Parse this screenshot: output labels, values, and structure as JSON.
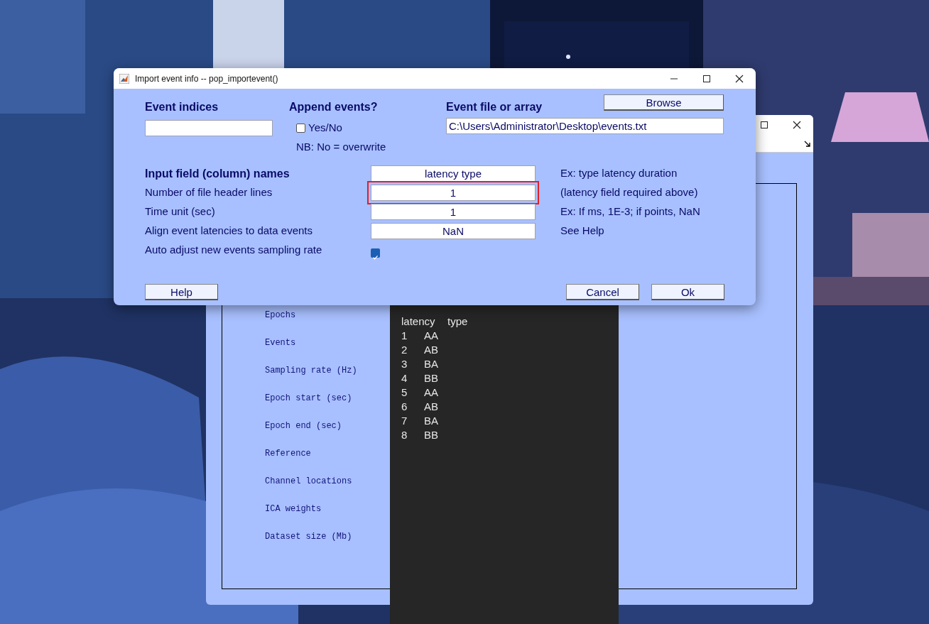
{
  "dialog": {
    "title": "Import event info -- pop_importevent()",
    "event_indices": {
      "heading": "Event indices"
    },
    "append_events": {
      "heading": "Append events?",
      "option": "Yes/No",
      "checked": false,
      "note": "NB: No = overwrite"
    },
    "event_file": {
      "heading": "Event file or array",
      "browse": "Browse",
      "value": "C:\\Users\\Administrator\\Desktop\\events.txt"
    },
    "rows": [
      {
        "kind": "field",
        "label": "Input field (column) names",
        "bold": true,
        "value": "latency type",
        "hint": "Ex: type latency duration",
        "highlighted": false
      },
      {
        "kind": "field",
        "label": "Number of file header lines",
        "bold": false,
        "value": "1",
        "hint": "(latency field required above)",
        "highlighted": true
      },
      {
        "kind": "field",
        "label": "Time unit (sec)",
        "bold": false,
        "value": "1",
        "hint": "Ex: If ms, 1E-3; if points, NaN",
        "highlighted": false
      },
      {
        "kind": "field",
        "label": "Align event latencies to data events",
        "bold": false,
        "value": "NaN",
        "hint": "See Help",
        "highlighted": false
      },
      {
        "kind": "checkbox",
        "label": "Auto adjust new events sampling rate",
        "bold": false,
        "checked": true
      }
    ],
    "buttons": [
      {
        "label": "Help"
      },
      {
        "label": "Cancel"
      },
      {
        "label": "Ok"
      }
    ]
  },
  "back_window": {
    "labels": [
      "Epochs",
      "Events",
      "Sampling rate (Hz)",
      "Epoch start (sec)",
      "Epoch end (sec)",
      "Reference",
      "Channel locations",
      "ICA weights",
      "Dataset size (Mb)"
    ]
  },
  "editor": {
    "columns": [
      "latency",
      "type"
    ],
    "rows": [
      [
        "1",
        "AA"
      ],
      [
        "2",
        "AB"
      ],
      [
        "3",
        "BA"
      ],
      [
        "4",
        "BB"
      ],
      [
        "5",
        "AA"
      ],
      [
        "6",
        "AB"
      ],
      [
        "7",
        "BA"
      ],
      [
        "8",
        "BB"
      ]
    ]
  }
}
